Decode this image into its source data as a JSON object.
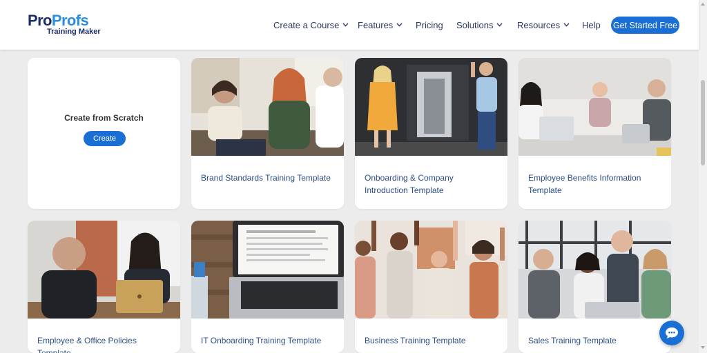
{
  "header": {
    "logo": {
      "brand_pro": "Pro",
      "brand_profs": "Profs",
      "subtitle": "Training Maker"
    },
    "nav": [
      {
        "label": "Create a Course",
        "has_dropdown": true
      },
      {
        "label": "Features",
        "has_dropdown": true
      },
      {
        "label": "Pricing",
        "has_dropdown": false
      },
      {
        "label": "Solutions",
        "has_dropdown": true
      },
      {
        "label": "Resources",
        "has_dropdown": true
      },
      {
        "label": "Help",
        "has_dropdown": false
      }
    ],
    "cta_label": "Get Started Free"
  },
  "scratch": {
    "title": "Create from Scratch",
    "button_label": "Create"
  },
  "templates": [
    {
      "title": "Brand Standards Training Template",
      "image": "office-meeting-photo"
    },
    {
      "title": "Onboarding & Company Introduction Template",
      "image": "office-welcome-photo"
    },
    {
      "title": "Employee Benefits Information Template",
      "image": "conference-room-photo"
    },
    {
      "title": "Employee & Office Policies Template",
      "image": "laptop-meeting-photo"
    },
    {
      "title": "IT Onboarding Training Template",
      "image": "laptop-desk-photo"
    },
    {
      "title": "Business Training Template",
      "image": "celebrating-team-photo"
    },
    {
      "title": "Sales Training Template",
      "image": "thumbs-up-team-photo"
    }
  ],
  "chat": {
    "icon": "chat-icon"
  },
  "colors": {
    "accent": "#1a6fd4",
    "brand_dark": "#1b2d6b",
    "brand_light": "#2d8de0",
    "link_text": "#2c4f86",
    "background": "#ececec"
  }
}
